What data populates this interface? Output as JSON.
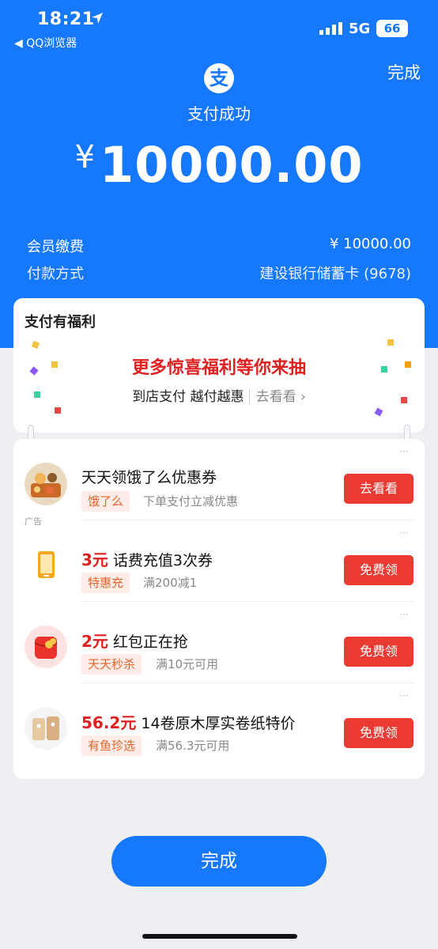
{
  "status_bar": {
    "time": "18:21",
    "back_app": "◀ QQ浏览器",
    "network": "5G",
    "battery": "66"
  },
  "header": {
    "done_label": "完成",
    "logo_char": "支",
    "title": "支付成功",
    "currency": "¥",
    "amount": "10000.00"
  },
  "details": [
    {
      "label": "会员缴费",
      "value": "¥ 10000.00"
    },
    {
      "label": "付款方式",
      "value": "建设银行储蓄卡 (9678)"
    }
  ],
  "benefit": {
    "heading": "支付有福利",
    "headline": "更多惊喜福利等你来抽",
    "subline": "到店支付 越付越惠",
    "link": "去看看 ›"
  },
  "coupons": [
    {
      "price": "",
      "title": "天天领饿了么优惠券",
      "tag": "饿了么",
      "desc": "下单支付立减优惠",
      "button": "去看看",
      "ad": "广告",
      "icon": "food-icon"
    },
    {
      "price": "3元",
      "title": "话费充值3次券",
      "tag": "特惠充",
      "desc": "满200减1",
      "button": "免费领",
      "ad": "",
      "icon": "phone-icon"
    },
    {
      "price": "2元",
      "title": "红包正在抢",
      "tag": "天天秒杀",
      "desc": "满10元可用",
      "button": "免费领",
      "ad": "",
      "icon": "red-packet-icon"
    },
    {
      "price": "56.2元",
      "title": "14卷原木厚实卷纸特价",
      "tag": "有鱼珍选",
      "desc": "满56.3元可用",
      "button": "免费领",
      "ad": "",
      "icon": "tissue-icon"
    }
  ],
  "footer": {
    "done_label": "完成"
  },
  "colors": {
    "brand": "#1677ff",
    "accent_red": "#ea3a32"
  }
}
